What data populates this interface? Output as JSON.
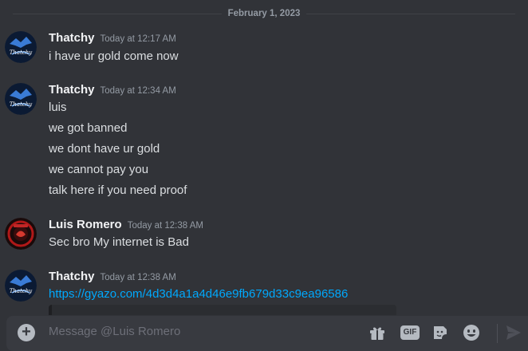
{
  "date_divider": "February 1, 2023",
  "messages": [
    {
      "author": "Thatchy",
      "time": "Today at 12:17 AM",
      "lines": [
        "i have ur gold come now"
      ]
    },
    {
      "author": "Thatchy",
      "time": "Today at 12:34 AM",
      "lines": [
        "luis",
        "we got banned",
        "we dont have ur gold",
        "we cannot pay you",
        "talk here if you need proof"
      ]
    },
    {
      "author": "Luis Romero",
      "time": "Today at 12:38 AM",
      "lines": [
        "Sec bro My internet is Bad"
      ]
    },
    {
      "author": "Thatchy",
      "time": "Today at 12:38 AM",
      "link": "https://gyazo.com/4d3d4a1a4d46e9fb679d33c9ea96586"
    }
  ],
  "composer": {
    "placeholder": "Message @Luis Romero",
    "gif_label": "GIF"
  },
  "colors": {
    "background": "#313338",
    "composer": "#383a40",
    "link": "#00a8fc",
    "username": "#f2f3f5",
    "timestamp": "#949ba4"
  },
  "icons": [
    "add-attachment-icon",
    "gift-icon",
    "gif-icon",
    "sticker-icon",
    "emoji-icon",
    "send-icon"
  ]
}
